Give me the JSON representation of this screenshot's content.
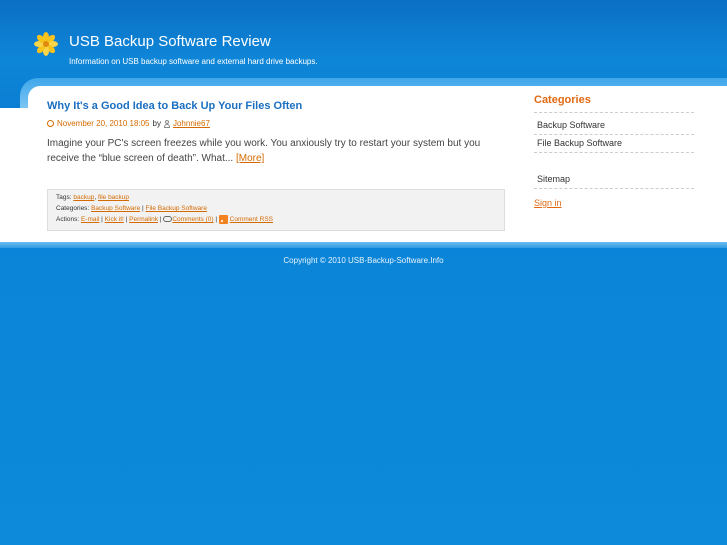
{
  "header": {
    "site_title": "USB Backup Software Review",
    "site_description": "Information on USB backup software and external hard drive backups."
  },
  "post": {
    "title": "Why It's a Good Idea to Back Up Your Files Often",
    "date": "November 20, 2010 18:05",
    "by": "by",
    "author": "Johnnie67",
    "excerpt": "Imagine your PC's screen freezes while you work. You anxiously try to restart your system but you receive the “blue screen of death”. What...",
    "more_label": "[More]",
    "tags_label": "Tags:",
    "tags": [
      "backup",
      "file backup"
    ],
    "categories_label": "Categories:",
    "categories": [
      "Backup Software",
      "File Backup Software"
    ],
    "actions_label": "Actions:",
    "actions": {
      "email": "E-mail",
      "kickit": "Kick it!",
      "permalink": "Permalink",
      "comments": "Comments (0)",
      "comment_rss": "Comment RSS"
    }
  },
  "sidebar": {
    "title": "Categories",
    "items": [
      "Backup Software",
      "File Backup Software"
    ],
    "sitemap": "Sitemap",
    "signin": "Sign in"
  },
  "footer": {
    "copyright": "Copyright © 2010 USB-Backup-Software.Info"
  },
  "colors": {
    "accent": "#e06a14",
    "title_blue": "#1a6fc1"
  }
}
